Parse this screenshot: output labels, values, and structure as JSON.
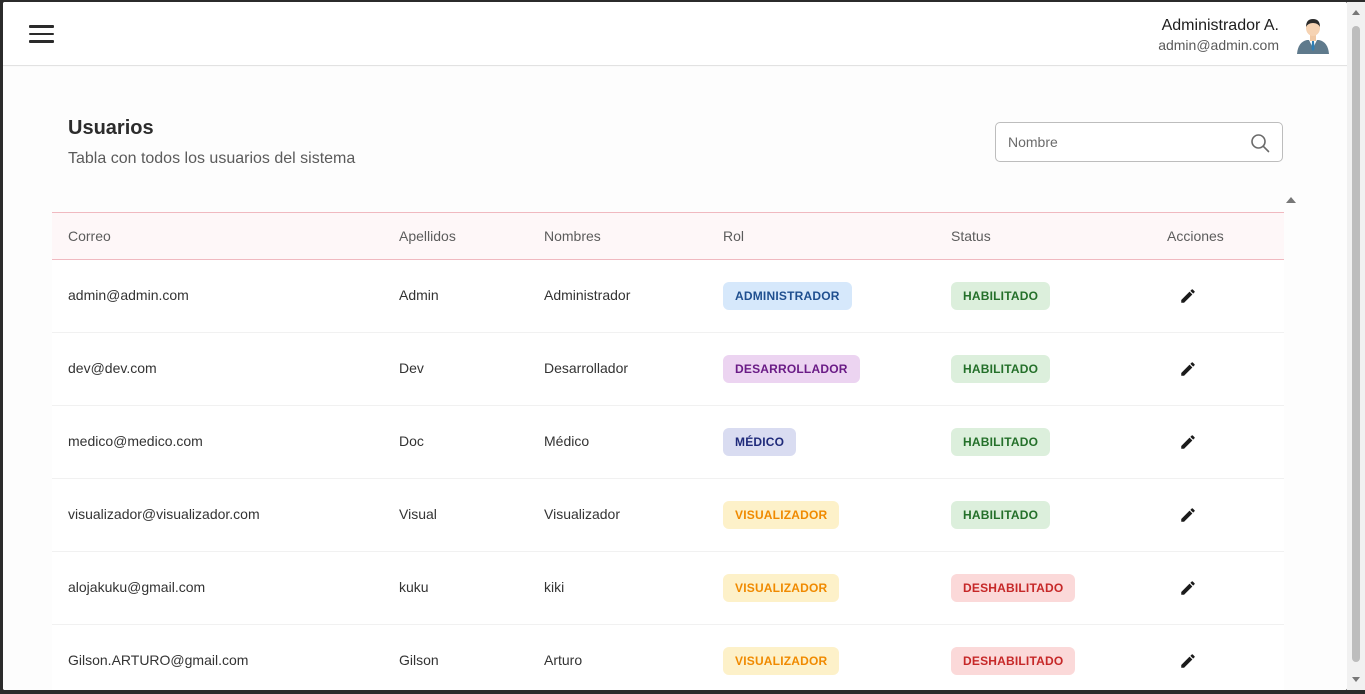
{
  "header": {
    "user_name": "Administrador A.",
    "user_email": "admin@admin.com"
  },
  "page": {
    "title": "Usuarios",
    "subtitle": "Tabla con todos los usuarios del sistema"
  },
  "search": {
    "placeholder": "Nombre",
    "value": ""
  },
  "table": {
    "columns": [
      "Correo",
      "Apellidos",
      "Nombres",
      "Rol",
      "Status",
      "Acciones"
    ],
    "rows": [
      {
        "correo": "admin@admin.com",
        "apellidos": "Admin",
        "nombres": "Administrador",
        "rol": "ADMINISTRADOR",
        "status": "HABILITADO"
      },
      {
        "correo": "dev@dev.com",
        "apellidos": "Dev",
        "nombres": "Desarrollador",
        "rol": "DESARROLLADOR",
        "status": "HABILITADO"
      },
      {
        "correo": "medico@medico.com",
        "apellidos": "Doc",
        "nombres": "Médico",
        "rol": "MÉDICO",
        "status": "HABILITADO"
      },
      {
        "correo": "visualizador@visualizador.com",
        "apellidos": "Visual",
        "nombres": "Visualizador",
        "rol": "VISUALIZADOR",
        "status": "HABILITADO"
      },
      {
        "correo": "alojakuku@gmail.com",
        "apellidos": "kuku",
        "nombres": "kiki",
        "rol": "VISUALIZADOR",
        "status": "DESHABILITADO"
      },
      {
        "correo": "Gilson.ARTURO@gmail.com",
        "apellidos": "Gilson",
        "nombres": "Arturo",
        "rol": "VISUALIZADOR",
        "status": "DESHABILITADO"
      }
    ]
  },
  "icons": {
    "menu": "hamburger-menu-icon",
    "avatar": "user-avatar-icon",
    "search": "search-icon",
    "edit": "pencil-edit-icon",
    "sort": "sort-arrow-icon"
  },
  "colors": {
    "chip_administrador": {
      "bg": "#d6e8fb",
      "fg": "#1f4f8f"
    },
    "chip_desarrollador": {
      "bg": "#ecd4f1",
      "fg": "#6a1b86"
    },
    "chip_medico": {
      "bg": "#d9dcf1",
      "fg": "#1f2a7a"
    },
    "chip_visualizador": {
      "bg": "#fdf1c9",
      "fg": "#f08a00"
    },
    "chip_habilitado": {
      "bg": "#dcefdc",
      "fg": "#24702a"
    },
    "chip_deshabilitado": {
      "bg": "#fbd9d9",
      "fg": "#c62828"
    },
    "header_border": "#f0b9c0"
  }
}
